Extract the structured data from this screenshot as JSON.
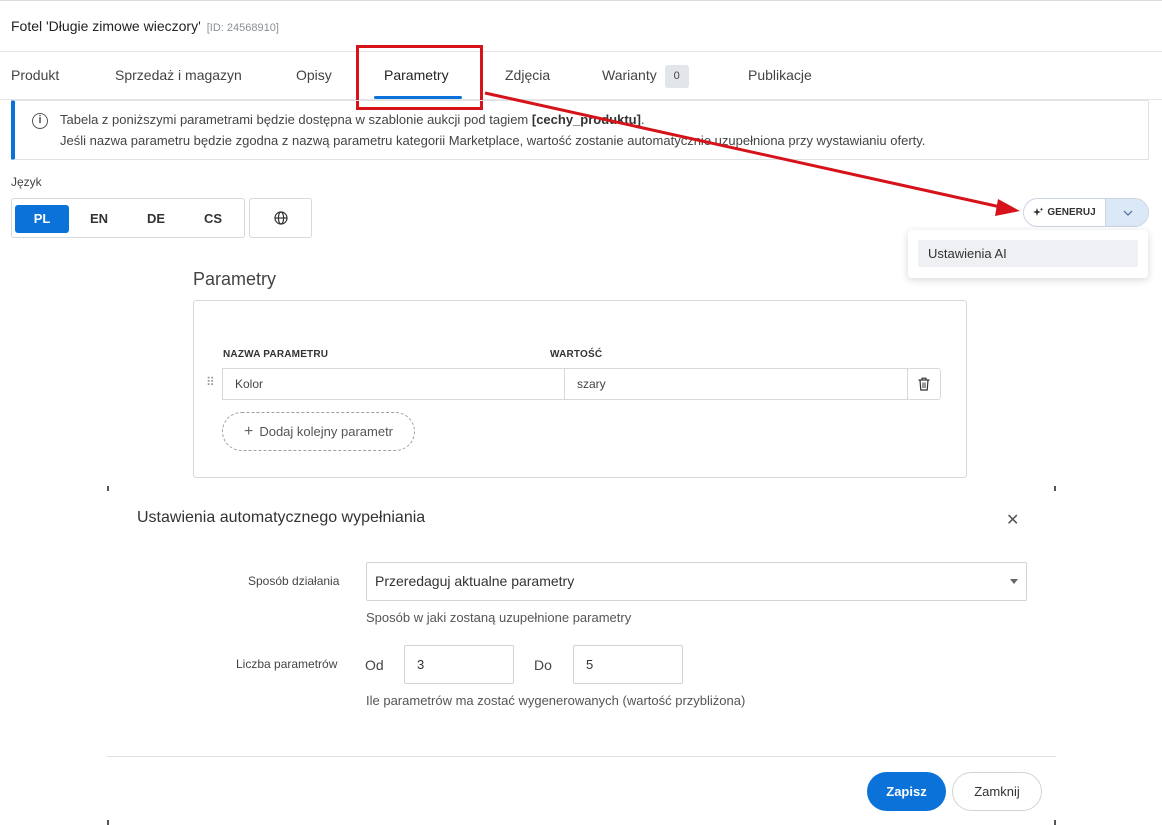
{
  "product": {
    "title": "Fotel 'Długie zimowe wieczory'",
    "id_label": "[ID: 24568910]"
  },
  "tabs": [
    {
      "label": "Produkt"
    },
    {
      "label": "Sprzedaż i magazyn"
    },
    {
      "label": "Opisy"
    },
    {
      "label": "Parametry"
    },
    {
      "label": "Zdjęcia"
    },
    {
      "label": "Warianty",
      "badge": "0"
    },
    {
      "label": "Publikacje"
    }
  ],
  "active_tab": "Parametry",
  "info": {
    "line1_pre": "Tabela z poniższymi parametrami będzie dostępna w szablonie aukcji pod tagiem ",
    "line1_tag": "[cechy_produktu]",
    "line1_post": ".",
    "line2": "Jeśli nazwa parametru będzie zgodna z nazwą parametru kategorii Marketplace, wartość zostanie automatycznie uzupełniona przy wystawianiu oferty."
  },
  "language": {
    "label": "Język",
    "options": [
      "PL",
      "EN",
      "DE",
      "CS"
    ],
    "selected": "PL"
  },
  "generate": {
    "label": "GENERUJ",
    "menu_items": [
      "Ustawienia AI"
    ]
  },
  "parameters": {
    "title": "Parametry",
    "col_name": "NAZWA PARAMETRU",
    "col_value": "WARTOŚĆ",
    "rows": [
      {
        "name": "Kolor",
        "value": "szary"
      }
    ],
    "add_label": "Dodaj kolejny parametr"
  },
  "modal": {
    "title": "Ustawienia automatycznego wypełniania",
    "mode_label": "Sposób działania",
    "mode_value": "Przeredaguj aktualne parametry",
    "mode_hint": "Sposób w jaki zostaną uzupełnione parametry",
    "count_label": "Liczba parametrów",
    "from_label": "Od",
    "from_value": "3",
    "to_label": "Do",
    "to_value": "5",
    "count_hint": "Ile parametrów ma zostać wygenerowanych (wartość przybliżona)",
    "save_label": "Zapisz",
    "close_label": "Zamknij"
  },
  "colors": {
    "accent": "#0a72d9",
    "annotation": "#d6121a"
  }
}
